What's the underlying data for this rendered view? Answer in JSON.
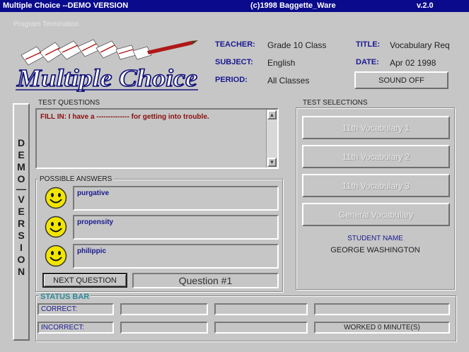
{
  "window": {
    "title": "Multiple Choice --DEMO VERSION",
    "copyright": "(c)1998 Baggette_Ware",
    "version": "v.2.0"
  },
  "menu": {
    "program_termination": "Program Termination"
  },
  "logo": {
    "text": "Multiple Choice"
  },
  "info": {
    "teacher_label": "TEACHER:",
    "teacher_value": "Grade 10 Class",
    "subject_label": "SUBJECT:",
    "subject_value": "English",
    "period_label": "PERIOD:",
    "period_value": "All Classes",
    "title_label": "TITLE:",
    "title_value": "Vocabulary Req",
    "date_label": "DATE:",
    "date_value": "Apr 02 1998",
    "sound_button": "SOUND OFF"
  },
  "demo_letters": [
    "D",
    "E",
    "M",
    "O",
    "",
    "V",
    "E",
    "R",
    "S",
    "I",
    "O",
    "N"
  ],
  "questions": {
    "label": "TEST QUESTIONS",
    "text": "FILL IN: I have a -------------- for getting into trouble."
  },
  "answers": {
    "label": "POSSIBLE ANSWERS",
    "items": [
      "purgative",
      "propensity",
      "philippic"
    ]
  },
  "next_button": "NEXT QUESTION",
  "question_number": "Question #1",
  "selections": {
    "label": "TEST SELECTIONS",
    "buttons": [
      "11th Vocabulary 1",
      "11th Vocabulary 2",
      "11th Vocabulary 3",
      "General Vocabulary"
    ],
    "student_name_label": "STUDENT NAME",
    "student_name": "GEORGE WASHINGTON"
  },
  "status": {
    "title": "STATUS BAR",
    "correct_label": "CORRECT:",
    "incorrect_label": "INCORRECT:",
    "worked": "WORKED 0 MINUTE(S)"
  },
  "colors": {
    "title_bar": "#0a0a8c",
    "label_blue": "#1a1a90",
    "question_red": "#8a1010",
    "status_teal": "#2a8a9a",
    "smiley_yellow": "#f2e600"
  },
  "icons": [
    "smiley-icon",
    "scroll-up-icon",
    "scroll-down-icon"
  ]
}
